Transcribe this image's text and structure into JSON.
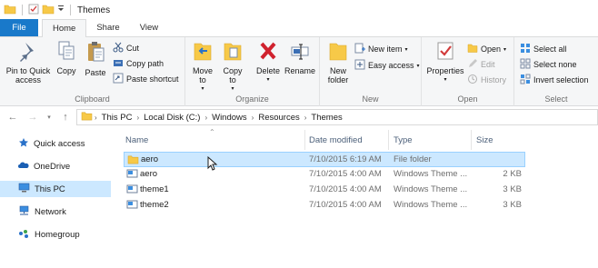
{
  "window": {
    "title": "Themes"
  },
  "ribbon_tabs": {
    "file": "File",
    "home": "Home",
    "share": "Share",
    "view": "View"
  },
  "clipboard": {
    "pin": "Pin to Quick access",
    "copy": "Copy",
    "paste": "Paste",
    "cut": "Cut",
    "copy_path": "Copy path",
    "paste_shortcut": "Paste shortcut",
    "label": "Clipboard"
  },
  "organize": {
    "move_to": "Move to",
    "copy_to": "Copy to",
    "delete": "Delete",
    "rename": "Rename",
    "label": "Organize"
  },
  "new_group": {
    "new_folder": "New folder",
    "new_item": "New item",
    "easy_access": "Easy access",
    "label": "New"
  },
  "open_group": {
    "properties": "Properties",
    "open": "Open",
    "edit": "Edit",
    "history": "History",
    "label": "Open"
  },
  "select_group": {
    "select_all": "Select all",
    "select_none": "Select none",
    "invert": "Invert selection",
    "label": "Select"
  },
  "breadcrumb": [
    "This PC",
    "Local Disk (C:)",
    "Windows",
    "Resources",
    "Themes"
  ],
  "navpane": [
    "Quick access",
    "OneDrive",
    "This PC",
    "Network",
    "Homegroup"
  ],
  "columns": {
    "name": "Name",
    "date": "Date modified",
    "type": "Type",
    "size": "Size"
  },
  "files": [
    {
      "name": "aero",
      "date": "7/10/2015 6:19 AM",
      "type": "File folder",
      "size": ""
    },
    {
      "name": "aero",
      "date": "7/10/2015 4:00 AM",
      "type": "Windows Theme ...",
      "size": "2 KB"
    },
    {
      "name": "theme1",
      "date": "7/10/2015 4:00 AM",
      "type": "Windows Theme ...",
      "size": "3 KB"
    },
    {
      "name": "theme2",
      "date": "7/10/2015 4:00 AM",
      "type": "Windows Theme ...",
      "size": "3 KB"
    }
  ],
  "colors": {
    "file_tab": "#1979ca",
    "selection": "#cce8ff",
    "selection_border": "#99d1ff",
    "folder": "#f7c948"
  }
}
